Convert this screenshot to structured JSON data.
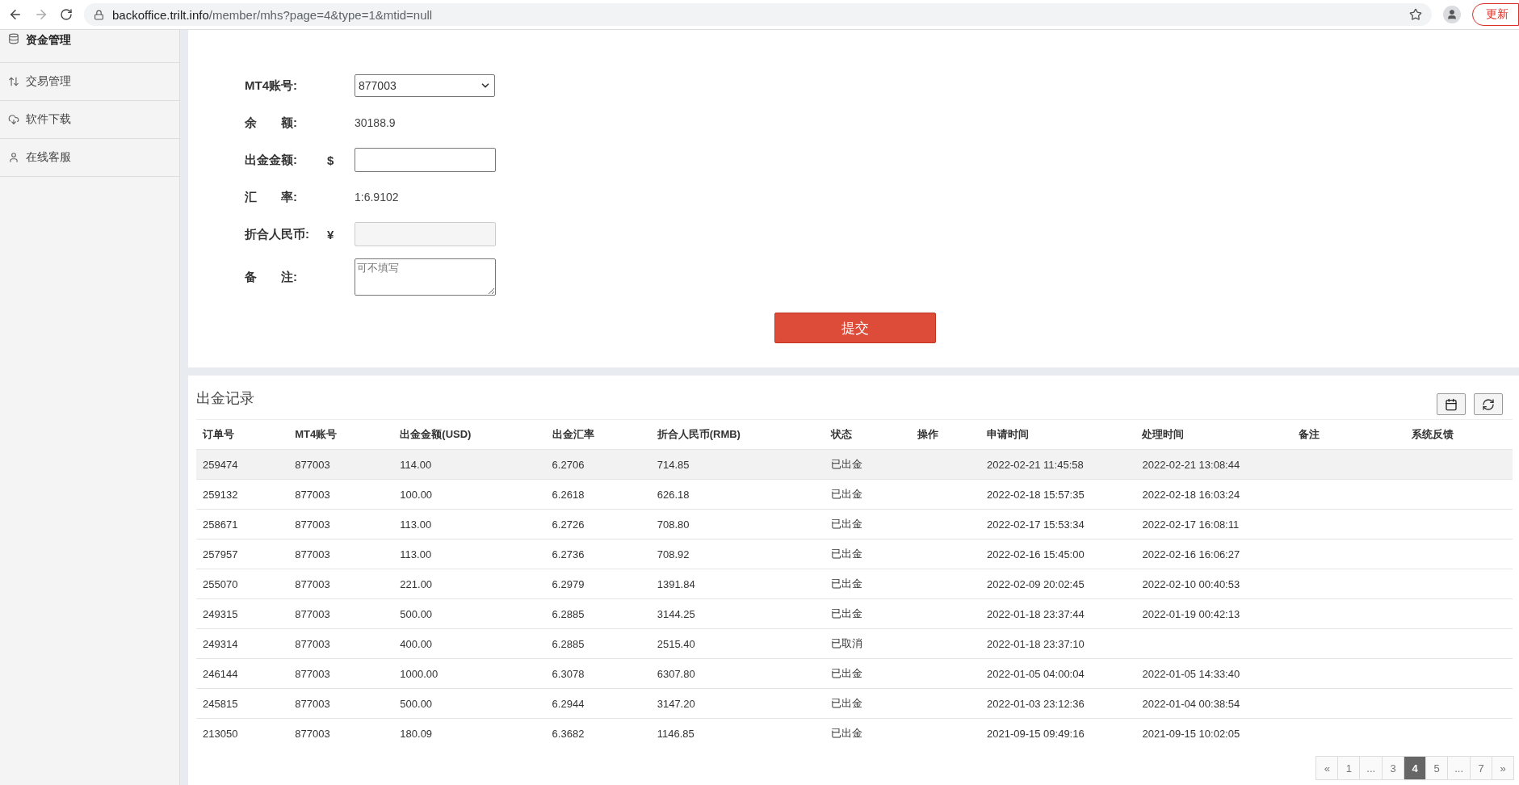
{
  "browser": {
    "url_host": "backoffice.trilt.info",
    "url_path": "/member/mhs?page=4&type=1&mtid=null",
    "update_button": "更新"
  },
  "sidebar": {
    "items": [
      {
        "label": "资金管理",
        "kind": "coins",
        "selected": true
      },
      {
        "label": "交易管理",
        "kind": "arrows",
        "selected": false
      },
      {
        "label": "软件下载",
        "kind": "cloud",
        "selected": false
      },
      {
        "label": "在线客服",
        "kind": "user",
        "selected": false
      }
    ]
  },
  "form": {
    "fields": [
      {
        "kind": "select",
        "label": "MT4账号:",
        "value": "877003"
      },
      {
        "kind": "text",
        "label": "余　　额:",
        "value": "30188.9"
      },
      {
        "kind": "input",
        "label": "出金金额:",
        "prefix": "$"
      },
      {
        "kind": "text",
        "label": "汇　　率:",
        "value": "1:6.9102"
      },
      {
        "kind": "disabled",
        "label": "折合人民币:",
        "prefix": "¥"
      },
      {
        "kind": "textarea",
        "label": "备　　注:",
        "placeholder": "可不填写"
      }
    ],
    "submit": "提交"
  },
  "records": {
    "title": "出金记录",
    "columns": [
      "订单号",
      "MT4账号",
      "出金金额(USD)",
      "出金汇率",
      "折合人民币(RMB)",
      "状态",
      "操作",
      "申请时间",
      "处理时间",
      "备注",
      "系统反馈"
    ],
    "rows": [
      {
        "cells": [
          "259474",
          "877003",
          "114.00",
          "6.2706",
          "714.85",
          "已出金",
          "",
          "2022-02-21 11:45:58",
          "2022-02-21 13:08:44",
          "",
          ""
        ],
        "selected": true
      },
      {
        "cells": [
          "259132",
          "877003",
          "100.00",
          "6.2618",
          "626.18",
          "已出金",
          "",
          "2022-02-18 15:57:35",
          "2022-02-18 16:03:24",
          "",
          ""
        ],
        "selected": false
      },
      {
        "cells": [
          "258671",
          "877003",
          "113.00",
          "6.2726",
          "708.80",
          "已出金",
          "",
          "2022-02-17 15:53:34",
          "2022-02-17 16:08:11",
          "",
          ""
        ],
        "selected": false
      },
      {
        "cells": [
          "257957",
          "877003",
          "113.00",
          "6.2736",
          "708.92",
          "已出金",
          "",
          "2022-02-16 15:45:00",
          "2022-02-16 16:06:27",
          "",
          ""
        ],
        "selected": false
      },
      {
        "cells": [
          "255070",
          "877003",
          "221.00",
          "6.2979",
          "1391.84",
          "已出金",
          "",
          "2022-02-09 20:02:45",
          "2022-02-10 00:40:53",
          "",
          ""
        ],
        "selected": false
      },
      {
        "cells": [
          "249315",
          "877003",
          "500.00",
          "6.2885",
          "3144.25",
          "已出金",
          "",
          "2022-01-18 23:37:44",
          "2022-01-19 00:42:13",
          "",
          ""
        ],
        "selected": false
      },
      {
        "cells": [
          "249314",
          "877003",
          "400.00",
          "6.2885",
          "2515.40",
          "已取消",
          "",
          "2022-01-18 23:37:10",
          "",
          "",
          ""
        ],
        "selected": false
      },
      {
        "cells": [
          "246144",
          "877003",
          "1000.00",
          "6.3078",
          "6307.80",
          "已出金",
          "",
          "2022-01-05 04:00:04",
          "2022-01-05 14:33:40",
          "",
          ""
        ],
        "selected": false
      },
      {
        "cells": [
          "245815",
          "877003",
          "500.00",
          "6.2944",
          "3147.20",
          "已出金",
          "",
          "2022-01-03 23:12:36",
          "2022-01-04 00:38:54",
          "",
          ""
        ],
        "selected": false
      },
      {
        "cells": [
          "213050",
          "877003",
          "180.09",
          "6.3682",
          "1146.85",
          "已出金",
          "",
          "2021-09-15 09:49:16",
          "2021-09-15 10:02:05",
          "",
          ""
        ],
        "selected": false
      }
    ],
    "pagination": [
      {
        "label": "«",
        "selected": false
      },
      {
        "label": "1",
        "selected": false
      },
      {
        "label": "...",
        "selected": false
      },
      {
        "label": "3",
        "selected": false
      },
      {
        "label": "4",
        "selected": true
      },
      {
        "label": "5",
        "selected": false
      },
      {
        "label": "...",
        "selected": false
      },
      {
        "label": "7",
        "selected": false
      },
      {
        "label": "»",
        "selected": false
      }
    ]
  }
}
